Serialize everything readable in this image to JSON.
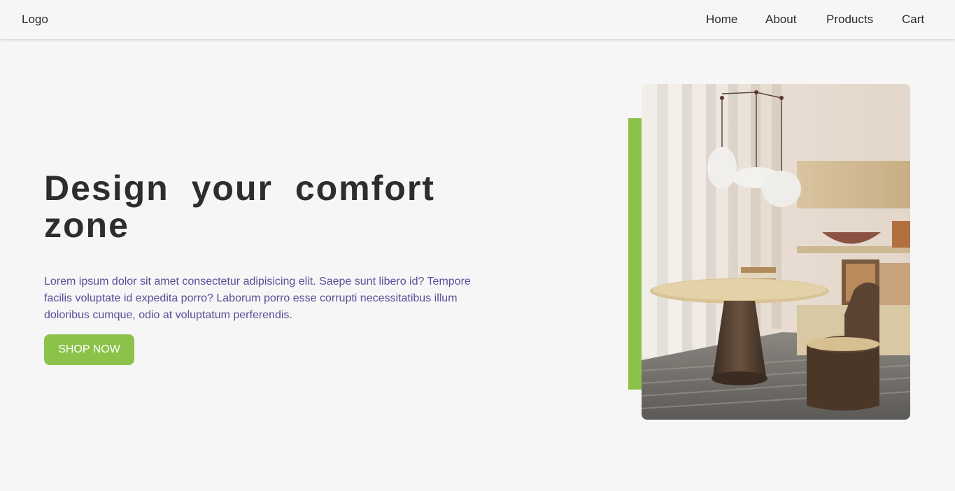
{
  "navbar": {
    "logo": "Logo",
    "links": [
      "Home",
      "About",
      "Products",
      "Cart"
    ]
  },
  "hero": {
    "title": "Design your comfort zone",
    "description": "Lorem ipsum dolor sit amet consectetur adipisicing elit. Saepe sunt libero id? Tempore facilis voluptate id expedita porro? Laborum porro esse corrupti necessitatibus illum doloribus cumque, odio at voluptatum perferendis.",
    "button_label": "SHOP NOW"
  },
  "colors": {
    "accent": "#8bc34a",
    "text": "#2d2d2d",
    "paragraph": "#5b4d98",
    "background": "#f6f6f6"
  },
  "icons": {
    "hero_image": "interior-dining-room-image"
  }
}
